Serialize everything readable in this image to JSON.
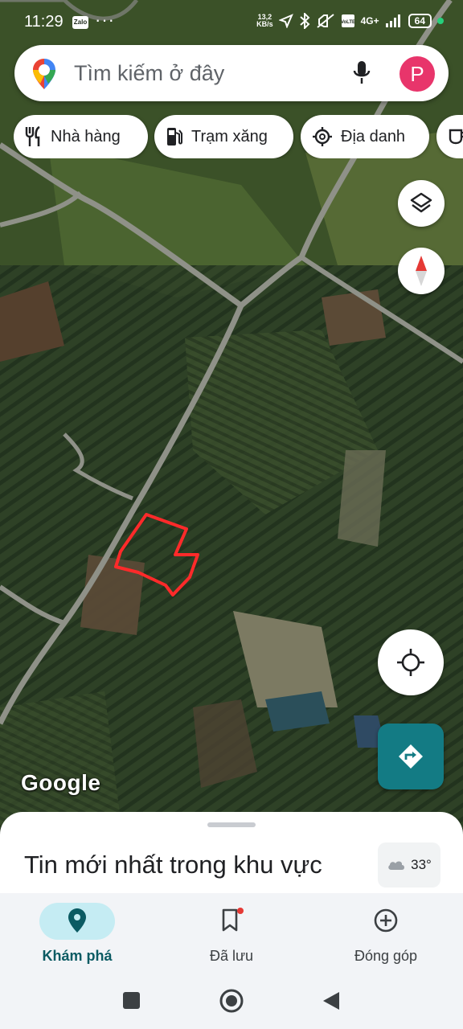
{
  "status_bar": {
    "time": "11:29",
    "zalo_label": "Zalo",
    "more": "···",
    "net_speed": "13,2",
    "net_unit": "KB/s",
    "network_type": "4G+",
    "battery": "64"
  },
  "search": {
    "placeholder": "Tìm kiếm ở đây",
    "avatar_letter": "P"
  },
  "chips": [
    {
      "label": "Nhà hàng",
      "icon": "restaurant-icon"
    },
    {
      "label": "Trạm xăng",
      "icon": "gas-station-icon"
    },
    {
      "label": "Địa danh",
      "icon": "landmark-icon"
    },
    {
      "label": "",
      "icon": "coffee-icon"
    }
  ],
  "map": {
    "attribution": "Google",
    "layers_icon": "layers-icon",
    "compass_icon": "compass-icon",
    "locate_icon": "my-location-icon",
    "directions_icon": "directions-icon"
  },
  "sheet": {
    "title": "Tin mới nhất trong khu vực",
    "weather": "33°"
  },
  "bottom_nav": [
    {
      "label": "Khám phá",
      "icon": "explore-pin-icon",
      "selected": true
    },
    {
      "label": "Đã lưu",
      "icon": "bookmark-icon",
      "selected": false
    },
    {
      "label": "Đóng góp",
      "icon": "add-circle-icon",
      "selected": false
    }
  ],
  "colors": {
    "accent_teal": "#137b84",
    "avatar": "#e8356b",
    "drawn_boundary": "#ff2a2a",
    "selected_tab": "#c5ecf3"
  }
}
